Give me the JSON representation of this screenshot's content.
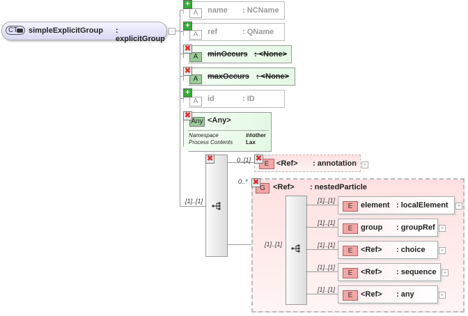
{
  "root": {
    "badge": "CT",
    "name": "simpleExplicitGroup",
    "type": ": explicitGroup"
  },
  "attributes": [
    {
      "tag": "A",
      "name": "name",
      "type": ": NCName",
      "status": "added"
    },
    {
      "tag": "A",
      "name": "ref",
      "type": ": QName",
      "status": "added"
    },
    {
      "tag": "A",
      "name": "minOccurs",
      "type": ": <None>",
      "status": "removed"
    },
    {
      "tag": "A",
      "name": "maxOccurs",
      "type": ": <None>",
      "status": "removed"
    },
    {
      "tag": "A",
      "name": "id",
      "type": ": ID",
      "status": "added"
    }
  ],
  "any": {
    "tag": "Any",
    "name": "<Any>",
    "ns_label": "Namespace",
    "ns_value": "##other",
    "pc_label": "Process Contents",
    "pc_value": "Lax"
  },
  "sequence": {
    "occurrence": "[1]..[1]"
  },
  "annotation": {
    "occurrence": "0..[1]",
    "tag": "E",
    "name": "<Ref>",
    "type": ": annotation"
  },
  "nested": {
    "occurrence": "0..*",
    "tag": "G",
    "name": "<Ref>",
    "type": ": nestedParticle",
    "seq_occurrence": "[1]..[1]",
    "children": [
      {
        "occurrence": "[1]..[1]",
        "tag": "E",
        "name": "element",
        "type": ": localElement"
      },
      {
        "occurrence": "[1]..[1]",
        "tag": "E",
        "name": "group",
        "type": ": groupRef"
      },
      {
        "occurrence": "[1]..[1]",
        "tag": "E",
        "name": "<Ref>",
        "type": ": choice"
      },
      {
        "occurrence": "[1]..[1]",
        "tag": "E",
        "name": "<Ref>",
        "type": ": sequence"
      },
      {
        "occurrence": "[1]..[1]",
        "tag": "E",
        "name": "<Ref>",
        "type": ": any"
      }
    ]
  }
}
